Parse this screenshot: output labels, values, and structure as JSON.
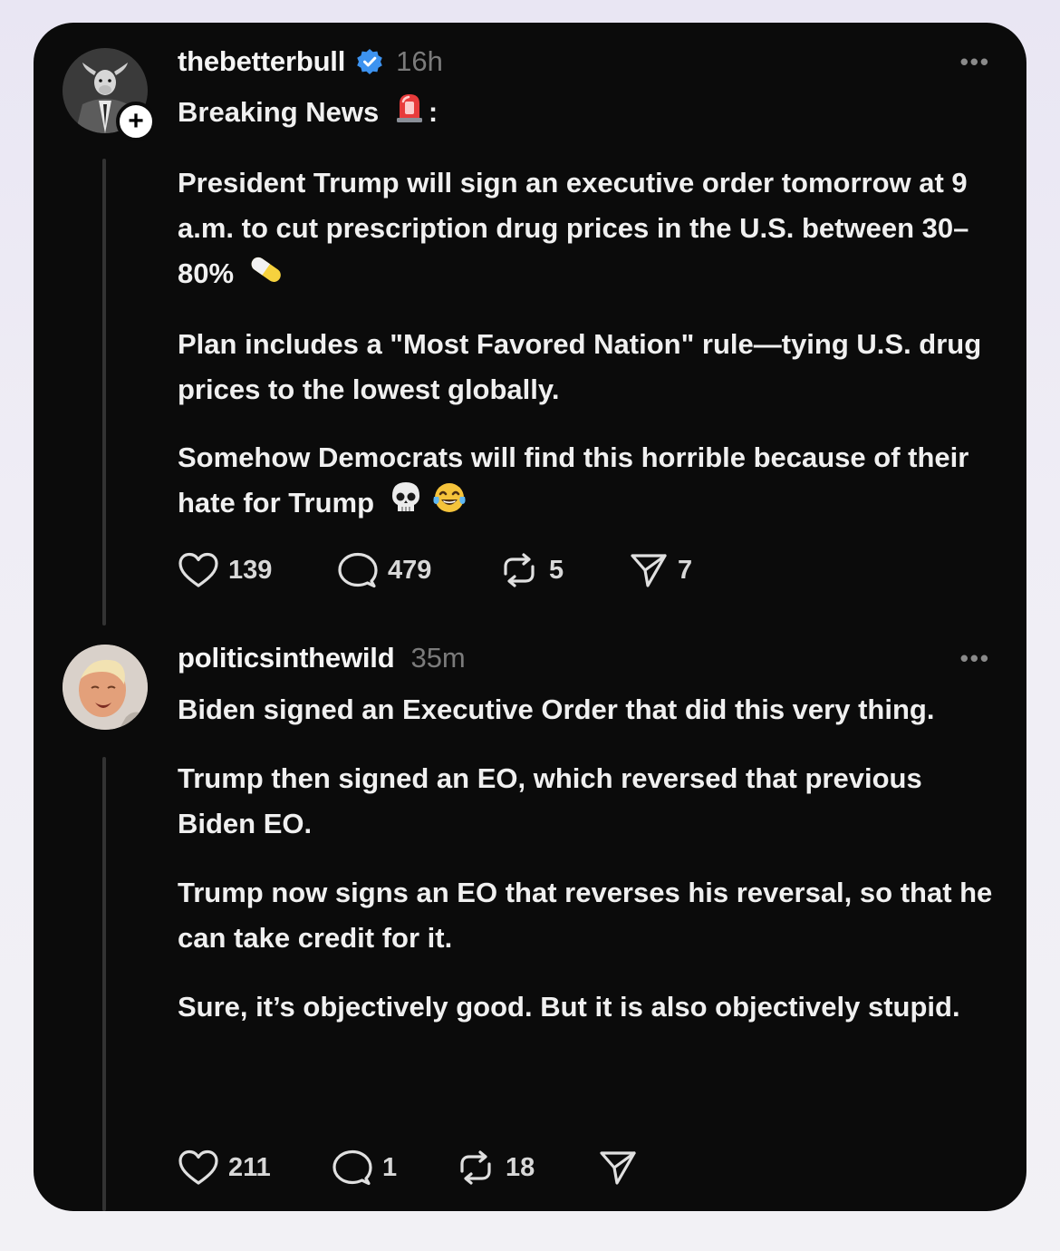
{
  "posts": [
    {
      "username": "thebetterbull",
      "verified": true,
      "timestamp": "16h",
      "avatar_icon": "bull-suit-avatar",
      "follow_badge": "+",
      "heading": "Breaking News",
      "heading_emoji": "siren-emoji",
      "heading_suffix": ":",
      "paragraphs": [
        "President Trump will sign an executive order tomorrow at 9 a.m. to cut prescription drug prices in the U.S. between 30–80%",
        "Plan includes a \"Most Favored Nation\" rule—tying U.S. drug prices to the lowest globally.",
        "Somehow Democrats will find this horrible because of their hate for Trump"
      ],
      "p1_emoji": "pill-emoji",
      "p3_emojis": [
        "skull-emoji",
        "tears-of-joy-emoji"
      ],
      "likes": "139",
      "replies": "479",
      "reposts": "5",
      "shares": "7"
    },
    {
      "username": "politicsinthewild",
      "verified": false,
      "timestamp": "35m",
      "avatar_icon": "face-photo-avatar",
      "paragraphs": [
        "Biden signed an Executive Order that did this very thing.",
        "Trump then signed an EO, which reversed that previous Biden EO.",
        "Trump now signs an EO that reverses his reversal, so that he can take credit for it.",
        "Sure, it’s objectively good. But it is also objectively stupid."
      ],
      "likes": "211",
      "replies": "1",
      "reposts": "18",
      "shares": ""
    }
  ],
  "more_label": "•••",
  "colors": {
    "card_bg": "#0b0b0b",
    "verified_blue": "#3d93f0",
    "muted": "#7b7b7b"
  }
}
